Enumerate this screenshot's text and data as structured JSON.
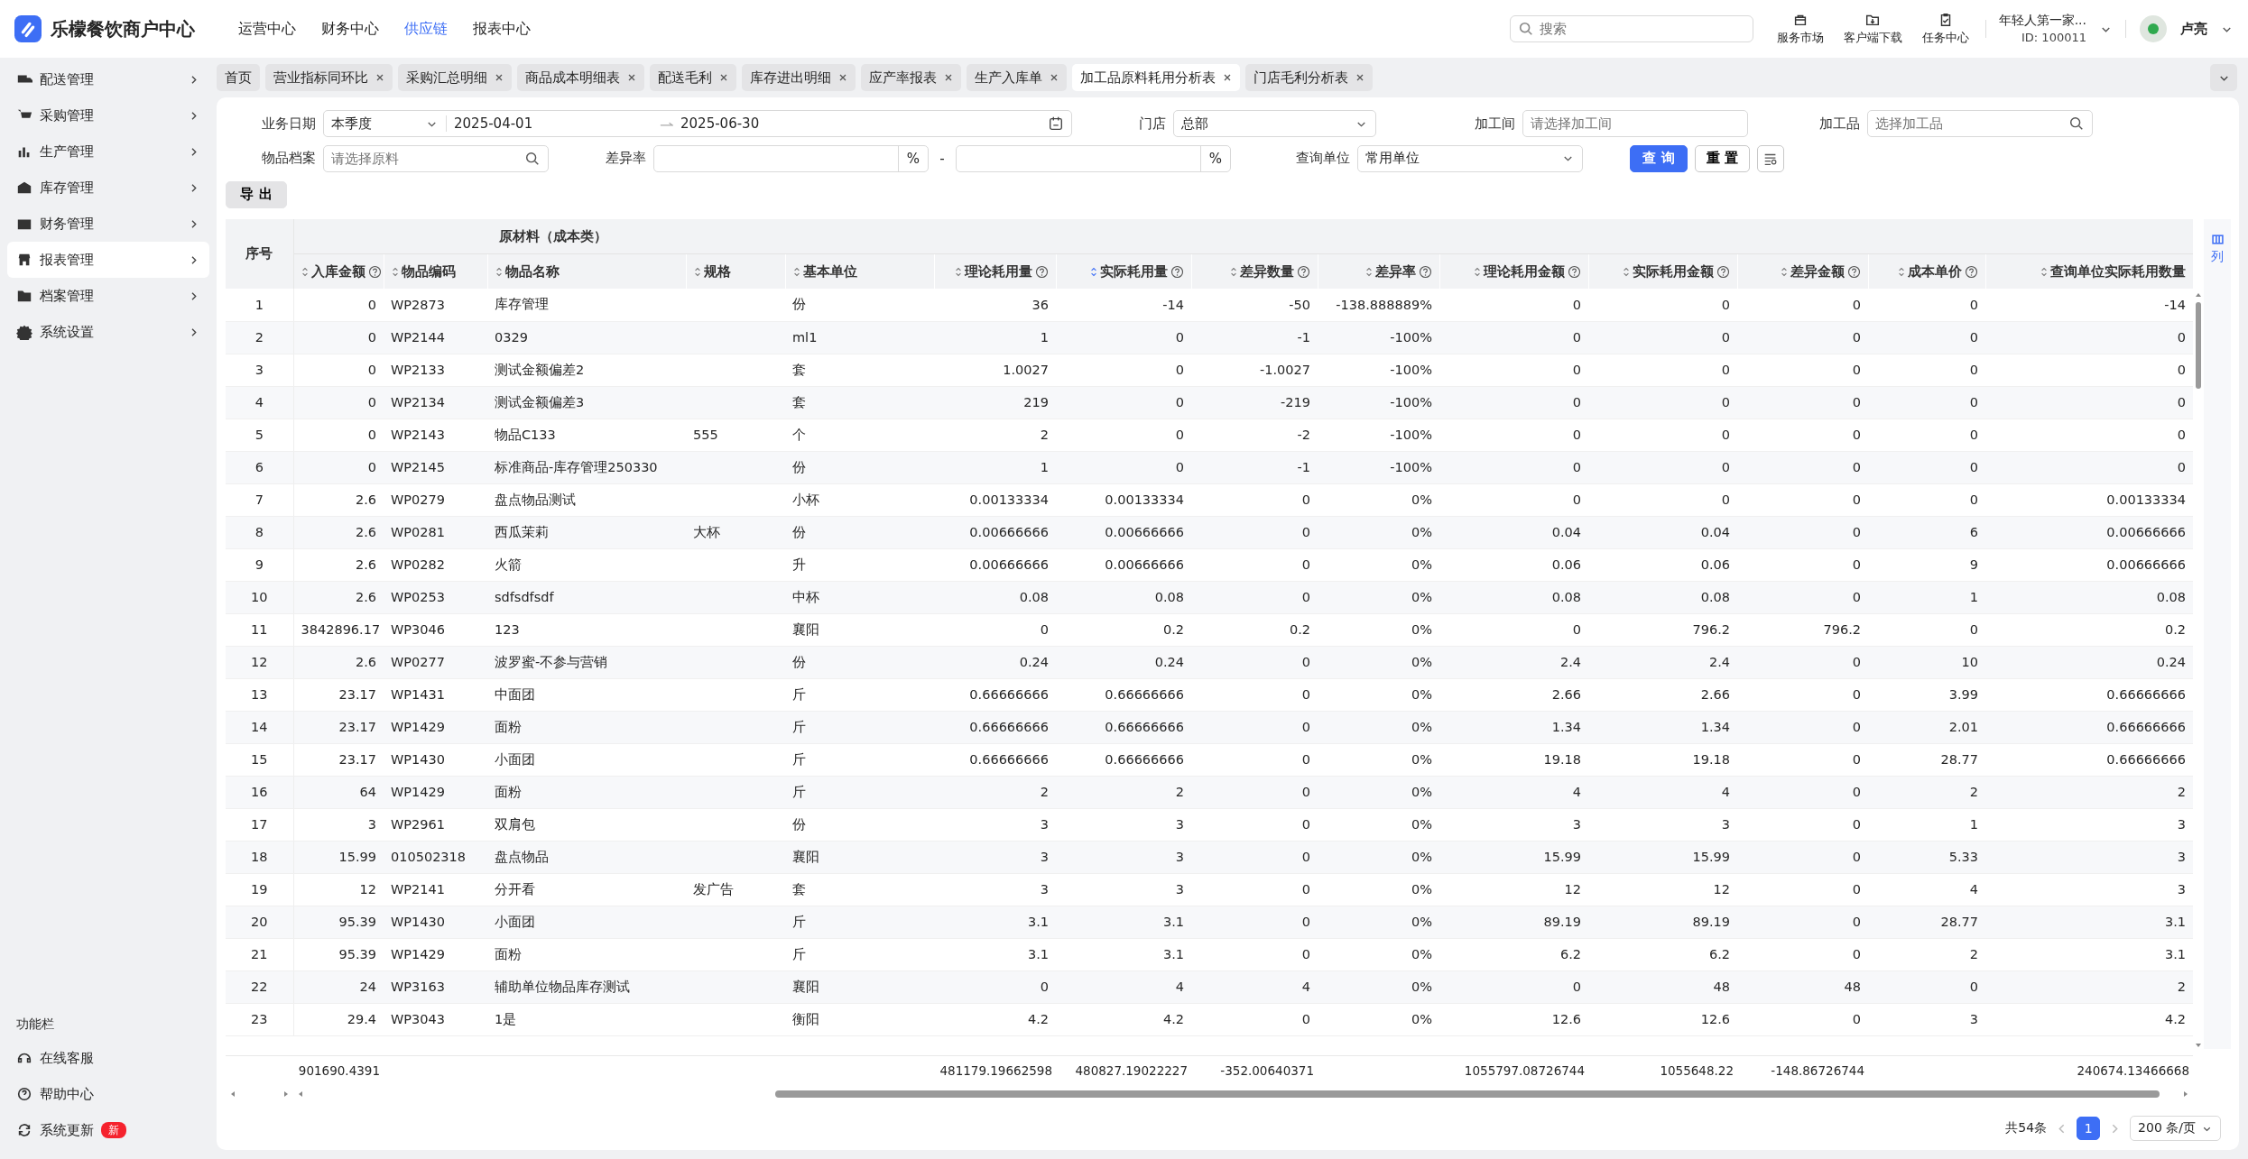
{
  "brand": {
    "name": "乐檬餐饮商户中心"
  },
  "nav": [
    {
      "label": "运营中心",
      "selected": false
    },
    {
      "label": "财务中心",
      "selected": false
    },
    {
      "label": "供应链",
      "selected": true
    },
    {
      "label": "报表中心",
      "selected": false
    }
  ],
  "search": {
    "placeholder": "搜索"
  },
  "tools": [
    {
      "label": "服务市场"
    },
    {
      "label": "客户端下载"
    },
    {
      "label": "任务中心"
    }
  ],
  "account": {
    "org": "年轻人第一家...",
    "id": "ID: 100011",
    "name": "卢亮"
  },
  "sidebar": {
    "items": [
      {
        "label": "配送管理",
        "selected": false
      },
      {
        "label": "采购管理",
        "selected": false
      },
      {
        "label": "生产管理",
        "selected": false
      },
      {
        "label": "库存管理",
        "selected": false
      },
      {
        "label": "财务管理",
        "selected": false
      },
      {
        "label": "报表管理",
        "selected": true
      },
      {
        "label": "档案管理",
        "selected": false
      },
      {
        "label": "系统设置",
        "selected": false
      }
    ],
    "footer_title": "功能栏",
    "footer_items": [
      {
        "label": "在线客服"
      },
      {
        "label": "帮助中心"
      },
      {
        "label": "系统更新",
        "badge": "新"
      }
    ]
  },
  "tabs": [
    {
      "label": "首页",
      "closable": false,
      "selected": false
    },
    {
      "label": "营业指标同环比",
      "closable": true,
      "selected": false
    },
    {
      "label": "采购汇总明细",
      "closable": true,
      "selected": false
    },
    {
      "label": "商品成本明细表",
      "closable": true,
      "selected": false
    },
    {
      "label": "配送毛利",
      "closable": true,
      "selected": false
    },
    {
      "label": "库存进出明细",
      "closable": true,
      "selected": false
    },
    {
      "label": "应产率报表",
      "closable": true,
      "selected": false
    },
    {
      "label": "生产入库单",
      "closable": true,
      "selected": false
    },
    {
      "label": "加工品原料耗用分析表",
      "closable": true,
      "selected": true
    },
    {
      "label": "门店毛利分析表",
      "closable": true,
      "selected": false
    }
  ],
  "filters": {
    "date": {
      "label": "业务日期",
      "preset": "本季度",
      "start": "2025-04-01",
      "end": "2025-06-30"
    },
    "store": {
      "label": "门店",
      "value": "总部"
    },
    "workshop": {
      "label": "加工间",
      "placeholder": "请选择加工间"
    },
    "product": {
      "label": "加工品",
      "placeholder": "选择加工品"
    },
    "item": {
      "label": "物品档案",
      "placeholder": "请选择原料"
    },
    "diff": {
      "label": "差异率",
      "unit_min": "%",
      "separator": "-",
      "unit_max": "%"
    },
    "unit": {
      "label": "查询单位",
      "value": "常用单位"
    }
  },
  "buttons": {
    "query": "查 询",
    "reset": "重 置",
    "export": "导 出"
  },
  "table": {
    "group_title": "原材料（成本类）",
    "index_title": "序号",
    "settings_label": "列",
    "columns": [
      {
        "label": "入库金额",
        "kind": "number",
        "help": true,
        "sorted": false
      },
      {
        "label": "物品编码",
        "kind": "text",
        "help": false,
        "sorted": false
      },
      {
        "label": "物品名称",
        "kind": "text",
        "help": false,
        "sorted": false
      },
      {
        "label": "规格",
        "kind": "text",
        "help": false,
        "sorted": false
      },
      {
        "label": "基本单位",
        "kind": "text",
        "help": false,
        "sorted": false
      },
      {
        "label": "理论耗用量",
        "kind": "number",
        "help": true,
        "sorted": false
      },
      {
        "label": "实际耗用量",
        "kind": "number",
        "help": true,
        "sorted": true
      },
      {
        "label": "差异数量",
        "kind": "number",
        "help": true,
        "sorted": false
      },
      {
        "label": "差异率",
        "kind": "number",
        "help": true,
        "sorted": false
      },
      {
        "label": "理论耗用金额",
        "kind": "number",
        "help": true,
        "sorted": false
      },
      {
        "label": "实际耗用金额",
        "kind": "number",
        "help": true,
        "sorted": false
      },
      {
        "label": "差异金额",
        "kind": "number",
        "help": true,
        "sorted": false
      },
      {
        "label": "成本单价",
        "kind": "number",
        "help": true,
        "sorted": false
      },
      {
        "label": "查询单位实际耗用数量",
        "kind": "number",
        "help": false,
        "sorted": false
      }
    ],
    "rows": [
      {
        "index": "1",
        "cells": [
          "0",
          "WP2873",
          "库存管理",
          "",
          "份",
          "36",
          "-14",
          "-50",
          "-138.888889%",
          "0",
          "0",
          "0",
          "0",
          "-14"
        ]
      },
      {
        "index": "2",
        "cells": [
          "0",
          "WP2144",
          "0329",
          "",
          "ml1",
          "1",
          "0",
          "-1",
          "-100%",
          "0",
          "0",
          "0",
          "0",
          "0"
        ]
      },
      {
        "index": "3",
        "cells": [
          "0",
          "WP2133",
          "测试金额偏差2",
          "",
          "套",
          "1.0027",
          "0",
          "-1.0027",
          "-100%",
          "0",
          "0",
          "0",
          "0",
          "0"
        ]
      },
      {
        "index": "4",
        "cells": [
          "0",
          "WP2134",
          "测试金额偏差3",
          "",
          "套",
          "219",
          "0",
          "-219",
          "-100%",
          "0",
          "0",
          "0",
          "0",
          "0"
        ]
      },
      {
        "index": "5",
        "cells": [
          "0",
          "WP2143",
          "物品C133",
          "555",
          "个",
          "2",
          "0",
          "-2",
          "-100%",
          "0",
          "0",
          "0",
          "0",
          "0"
        ]
      },
      {
        "index": "6",
        "cells": [
          "0",
          "WP2145",
          "标准商品-库存管理250330",
          "",
          "份",
          "1",
          "0",
          "-1",
          "-100%",
          "0",
          "0",
          "0",
          "0",
          "0"
        ]
      },
      {
        "index": "7",
        "cells": [
          "2.6",
          "WP0279",
          "盘点物品测试",
          "",
          "小杯",
          "0.00133334",
          "0.00133334",
          "0",
          "0%",
          "0",
          "0",
          "0",
          "0",
          "0.00133334"
        ]
      },
      {
        "index": "8",
        "cells": [
          "2.6",
          "WP0281",
          "西瓜茉莉",
          "大杯",
          "份",
          "0.00666666",
          "0.00666666",
          "0",
          "0%",
          "0.04",
          "0.04",
          "0",
          "6",
          "0.00666666"
        ]
      },
      {
        "index": "9",
        "cells": [
          "2.6",
          "WP0282",
          "火箭",
          "",
          "升",
          "0.00666666",
          "0.00666666",
          "0",
          "0%",
          "0.06",
          "0.06",
          "0",
          "9",
          "0.00666666"
        ]
      },
      {
        "index": "10",
        "cells": [
          "2.6",
          "WP0253",
          "sdfsdfsdf",
          "",
          "中杯",
          "0.08",
          "0.08",
          "0",
          "0%",
          "0.08",
          "0.08",
          "0",
          "1",
          "0.08"
        ]
      },
      {
        "index": "11",
        "cells": [
          "3842896.17",
          "WP3046",
          "123",
          "",
          "襄阳",
          "0",
          "0.2",
          "0.2",
          "0%",
          "0",
          "796.2",
          "796.2",
          "0",
          "0.2"
        ]
      },
      {
        "index": "12",
        "cells": [
          "2.6",
          "WP0277",
          "波罗蜜-不参与营销",
          "",
          "份",
          "0.24",
          "0.24",
          "0",
          "0%",
          "2.4",
          "2.4",
          "0",
          "10",
          "0.24"
        ]
      },
      {
        "index": "13",
        "cells": [
          "23.17",
          "WP1431",
          "中面团",
          "",
          "斤",
          "0.66666666",
          "0.66666666",
          "0",
          "0%",
          "2.66",
          "2.66",
          "0",
          "3.99",
          "0.66666666"
        ]
      },
      {
        "index": "14",
        "cells": [
          "23.17",
          "WP1429",
          "面粉",
          "",
          "斤",
          "0.66666666",
          "0.66666666",
          "0",
          "0%",
          "1.34",
          "1.34",
          "0",
          "2.01",
          "0.66666666"
        ]
      },
      {
        "index": "15",
        "cells": [
          "23.17",
          "WP1430",
          "小面团",
          "",
          "斤",
          "0.66666666",
          "0.66666666",
          "0",
          "0%",
          "19.18",
          "19.18",
          "0",
          "28.77",
          "0.66666666"
        ]
      },
      {
        "index": "16",
        "cells": [
          "64",
          "WP1429",
          "面粉",
          "",
          "斤",
          "2",
          "2",
          "0",
          "0%",
          "4",
          "4",
          "0",
          "2",
          "2"
        ]
      },
      {
        "index": "17",
        "cells": [
          "3",
          "WP2961",
          "双肩包",
          "",
          "份",
          "3",
          "3",
          "0",
          "0%",
          "3",
          "3",
          "0",
          "1",
          "3"
        ]
      },
      {
        "index": "18",
        "cells": [
          "15.99",
          "010502318",
          "盘点物品",
          "",
          "襄阳",
          "3",
          "3",
          "0",
          "0%",
          "15.99",
          "15.99",
          "0",
          "5.33",
          "3"
        ]
      },
      {
        "index": "19",
        "cells": [
          "12",
          "WP2141",
          "分开看",
          "发广告",
          "套",
          "3",
          "3",
          "0",
          "0%",
          "12",
          "12",
          "0",
          "4",
          "3"
        ]
      },
      {
        "index": "20",
        "cells": [
          "95.39",
          "WP1430",
          "小面团",
          "",
          "斤",
          "3.1",
          "3.1",
          "0",
          "0%",
          "89.19",
          "89.19",
          "0",
          "28.77",
          "3.1"
        ]
      },
      {
        "index": "21",
        "cells": [
          "95.39",
          "WP1429",
          "面粉",
          "",
          "斤",
          "3.1",
          "3.1",
          "0",
          "0%",
          "6.2",
          "6.2",
          "0",
          "2",
          "3.1"
        ]
      },
      {
        "index": "22",
        "cells": [
          "24",
          "WP3163",
          "辅助单位物品库存测试",
          "",
          "襄阳",
          "0",
          "4",
          "4",
          "0%",
          "0",
          "48",
          "48",
          "0",
          "2"
        ]
      },
      {
        "index": "23",
        "cells": [
          "29.4",
          "WP3043",
          "1是",
          "",
          "衡阳",
          "4.2",
          "4.2",
          "0",
          "0%",
          "12.6",
          "12.6",
          "0",
          "3",
          "4.2"
        ]
      }
    ],
    "totals": {
      "column_1": "901690.4391",
      "column_6": "481179.19662598",
      "column_7": "480827.19022227",
      "column_8": "-352.00640371",
      "column_10": "1055797.08726744",
      "column_11": "1055648.22",
      "column_12": "-148.86726744",
      "column_14": "240674.13466668"
    }
  },
  "pagination": {
    "total": "共54条",
    "pages": [
      {
        "label": "1",
        "selected": true
      }
    ],
    "page_size": "200 条/页"
  }
}
